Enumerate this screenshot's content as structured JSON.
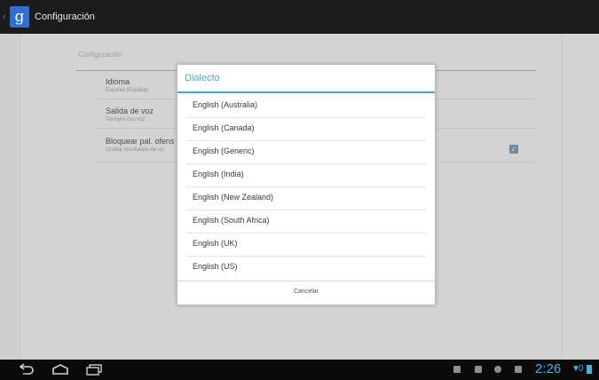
{
  "app": {
    "title": "Configuración"
  },
  "settings": {
    "section_header": "Configuración",
    "items": [
      {
        "title": "Idioma",
        "summary": "Español (España)"
      },
      {
        "title": "Salida de voz",
        "summary": "Siempre con voz"
      },
      {
        "title": "Bloquear pal. ofens",
        "summary": "Ocultar resultados de vo"
      }
    ]
  },
  "dialog": {
    "title": "Dialecto",
    "options": [
      "English (Australia)",
      "English (Canada)",
      "English (Generic)",
      "English (India)",
      "English (New Zealand)",
      "English (South Africa)",
      "English (UK)",
      "English (US)"
    ],
    "cancel_label": "Cancelar"
  },
  "system_bar": {
    "time": "2:26",
    "badge": "0"
  },
  "colors": {
    "accent": "#39a9e0",
    "action_bar": "#1b1b1b",
    "system_bar": "#0a0a0a"
  }
}
